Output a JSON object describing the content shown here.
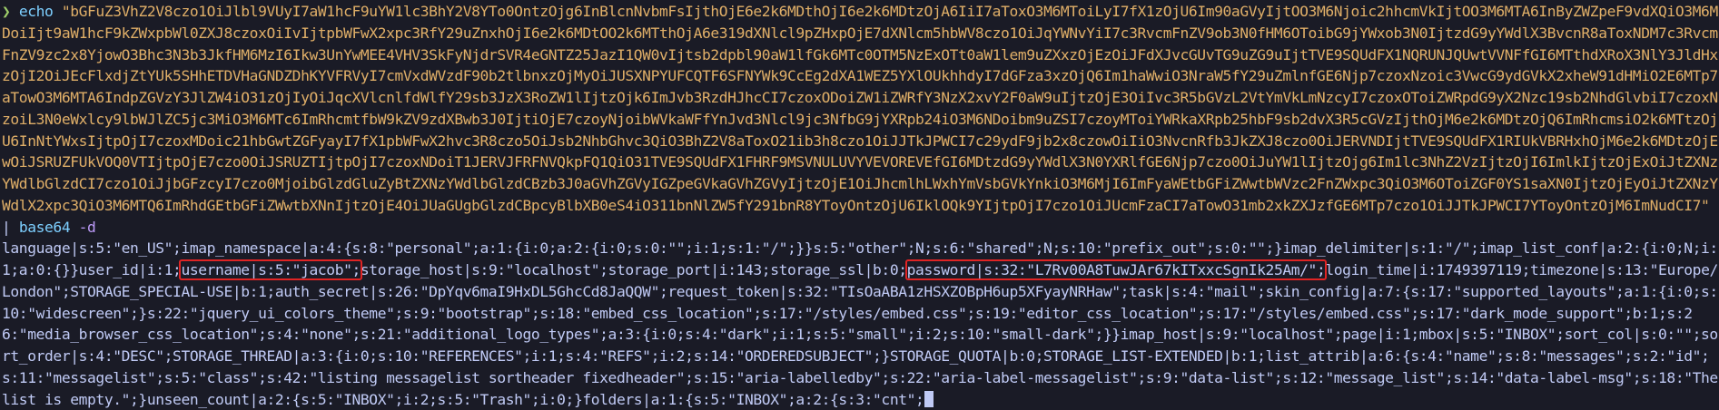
{
  "terminal": {
    "prompt_symbol": "❯",
    "command": "echo",
    "encoded_string": "\"bGFuZ3VhZ2V8czo1OiJlbl9VUyI7aW1hcF9uYW1lc3BhY2V8YTo0OntzOjg6InBlcnNvbmFsIjthOjE6e2k6MDthOjI6e2k6MDtzOjA6IiI7aToxO3M6MToiLyI7fX1zOjU6Im90aGVyIjtOO3M6Njoic2hhcmVkIjtOO3M6MTA6InByZWZpeF9vdXQiO3M6MDoiIjt9aW1hcF9kZWxpbWl0ZXJ8czoxOiIvIjtpbWFwX2xpc3RfY29uZnxhOjI6e2k6MDtOO2k6MTthOjA6e319dXNlcl9pZHxpOjE7dXNlcm5hbWV8czo1OiJqYWNvYiI7c3RvcmFnZV9ob3N0fHM6OToibG9jYWxob3N0IjtzdG9yYWdlX3BvcnR8aToxNDM7c3RvcmFnZV9zc2x8YjowO3Bhc3N3b3JkfHM6MzI6Ikw3UnYwMEE4VHV3SkFyNjdrSVR4eGNTZ25JazI1QW0vIjtsb2dpbl90aW1lfGk6MTc0OTM5NzExOTt0aW1lem9uZXxzOjEzOiJFdXJvcGUvTG9uZG9uIjtTVE9SQUdFX1NQRUNJQUwtVVNFfGI6MTthdXRoX3NlY3JldHxzOjI2OiJEcFlxdjZtYUk5SHhETDVHaGNDZDhKYVFRVyI7cmVxdWVzdF90b2tlbnxzOjMyOiJUSXNPYUFCQTF6SFNYWk9CcEg2dXA1WEZ5YXlOUkhhdyI7dGFza3xzOjQ6Im1haWwiO3NraW5fY29uZmlnfGE6Njp7czoxNzoic3VwcG9ydGVkX2xheW91dHMiO2E6MTp7aTowO3M6MTA6IndpZGVzY3JlZW4iO31zOjIyOiJqcXVlcnlfdWlfY29sb3JzX3RoZW1lIjtzOjk6ImJvb3RzdHJhcCI7czoxODoiZW1iZWRfY3NzX2xvY2F0aW9uIjtzOjE3OiIvc3R5bGVzL2VtYmVkLmNzcyI7czoxOToiZWRpdG9yX2Nzc19sb2NhdGlvbiI7czoxNzoiL3N0eWxlcy9lbWJlZC5jc3MiO3M6MTc6ImRhcmtfbW9kZV9zdXBwb3J0IjtiOjE7czoyNjoibWVkaWFfYnJvd3Nlcl9jc3NfbG9jYXRpb24iO3M6NDoibm9uZSI7czoyMToiYWRkaXRpb25hbF9sb2dvX3R5cGVzIjthOjM6e2k6MDtzOjQ6ImRhcmsiO2k6MTtzOjU6InNtYWxsIjtpOjI7czoxMDoic21hbGwtZGFyayI7fX1pbWFwX2hvc3R8czo5OiJsb2NhbGhvc3QiO3BhZ2V8aToxO21ib3h8czo1OiJJTkJPWCI7c29ydF9jb2x8czowOiIiO3NvcnRfb3JkZXJ8czo0OiJERVNDIjtTVE9SQUdFX1RIUkVBRHxhOjM6e2k6MDtzOjEwOiJSRUZFUkVOQ0VTIjtpOjE7czo0OiJSRUZTIjtpOjI7czoxNDoiT1JERVJFRFNVQkpFQ1QiO31TVE9SQUdFX1FHRF9MSVNULUVYVEVOREVEfGI6MDtzdG9yYWdlX3N0YXRlfGE6Njp7czo0OiJuYW1lIjtzOjg6Im1lc3NhZ2VzIjtzOjI6ImlkIjtzOjExOiJtZXNzYWdlbGlzdCI7czo1OiJjbGFzcyI7czo0MjoibGlzdGluZyBtZXNzYWdlbGlzdCBzb3J0aGVhZGVyIGZpeGVkaGVhZGVyIjtzOjE1OiJhcmlhLWxhYmVsbGVkYnkiO3M6MjI6ImFyaWEtbGFiZWwtbWVzc2FnZWxpc3QiO3M6OToiZGF0YS1saXN0IjtzOjEyOiJtZXNzYWdlX2xpc3QiO3M6MTQ6ImRhdGEtbGFiZWwtbXNnIjtzOjE4OiJUaGUgbGlzdCBpcyBlbXB0eS4iO311bnNlZW5fY291bnR8YToyOntzOjU6IklOQk9YIjtpOjI7czo1OiJUcmFzaCI7aTowO31mb2xkZXJzfGE6MTp7czo1OiJJTkJPWCI7YToyOntzOjM6ImNudCI7\"",
    "pipe": "|",
    "pipe_command": "base64",
    "pipe_flag": "-d",
    "output_before_username": "language|s:5:\"en_US\";imap_namespace|a:4:{s:8:\"personal\";a:1:{i:0;a:2:{i:0;s:0:\"\";i:1;s:1:\"/\";}}s:5:\"other\";N;s:6:\"shared\";N;s:10:\"prefix_out\";s:0:\"\";}imap_delimiter|s:1:\"/\";imap_list_conf|a:2:{i:0;N;i:1;a:0:{}}user_id|i:1;",
    "highlight_username": "username|s:5:\"jacob\";",
    "output_between": "storage_host|s:9:\"localhost\";storage_port|i:143;storage_ssl|b:0;",
    "highlight_password": "password|s:32:\"L7Rv00A8TuwJAr67kITxxcSgnIk25Am/\";",
    "output_after_password": "login_time|i:1749397119;timezone|s:13:\"Europe/London\";STORAGE_SPECIAL-USE|b:1;auth_secret|s:26:\"DpYqv6maI9HxDL5GhcCd8JaQQW\";request_token|s:32:\"TIsOaABA1zHSXZOBpH6up5XFyayNRHaw\";task|s:4:\"mail\";skin_config|a:7:{s:17:\"supported_layouts\";a:1:{i:0;s:10:\"widescreen\";}s:22:\"jquery_ui_colors_theme\";s:9:\"bootstrap\";s:18:\"embed_css_location\";s:17:\"/styles/embed.css\";s:19:\"editor_css_location\";s:17:\"/styles/embed.css\";s:17:\"dark_mode_support\";b:1;s:26:\"media_browser_css_location\";s:4:\"none\";s:21:\"additional_logo_types\";a:3:{i:0;s:4:\"dark\";i:1;s:5:\"small\";i:2;s:10:\"small-dark\";}}imap_host|s:9:\"localhost\";page|i:1;mbox|s:5:\"INBOX\";sort_col|s:0:\"\";sort_order|s:4:\"DESC\";STORAGE_THREAD|a:3:{i:0;s:10:\"REFERENCES\";i:1;s:4:\"REFS\";i:2;s:14:\"ORDEREDSUBJECT\";}STORAGE_QUOTA|b:0;STORAGE_LIST-EXTENDED|b:1;list_attrib|a:6:{s:4:\"name\";s:8:\"messages\";s:2:\"id\";s:11:\"messagelist\";s:5:\"class\";s:42:\"listing messagelist sortheader fixedheader\";s:15:\"aria-labelledby\";s:22:\"aria-label-messagelist\";s:9:\"data-list\";s:12:\"message_list\";s:14:\"data-label-msg\";s:18:\"The list is empty.\";}unseen_count|a:2:{s:5:\"INBOX\";i:2;s:5:\"Trash\";i:0;}folders|a:1:{s:5:\"INBOX\";a:2:{s:3:\"cnt\";"
  },
  "colors": {
    "background": "#1a1b26",
    "prompt": "#9ece6a",
    "command": "#7dcfff",
    "string": "#e0af68",
    "text": "#c0caf5",
    "highlight_box": "#e02424"
  }
}
